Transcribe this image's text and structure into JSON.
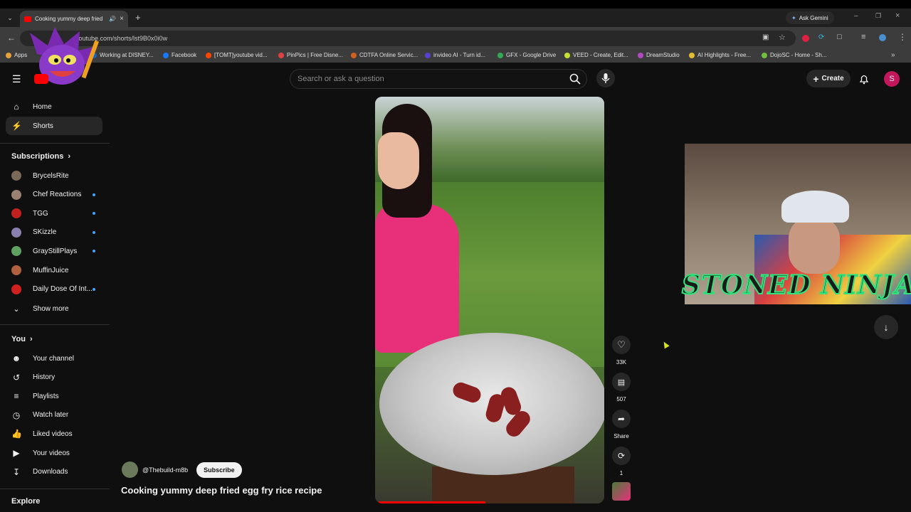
{
  "browser": {
    "tab_title": "Cooking yummy deep fried",
    "url": "youtube.com/shorts/lst9B0x0i0w",
    "ask_gemini": "Ask Gemini",
    "bookmarks": [
      {
        "label": "Apps",
        "color": "#e8a13a"
      },
      {
        "label": "Working at DISNEY...",
        "color": "#1565c0"
      },
      {
        "label": "Facebook",
        "color": "#1877f2"
      },
      {
        "label": "[TOMT]youtube vid...",
        "color": "#ff4500"
      },
      {
        "label": "PinPics | Free Disne...",
        "color": "#e04040"
      },
      {
        "label": "CDTFA Online Servic...",
        "color": "#d06020"
      },
      {
        "label": "invideo AI - Turn id...",
        "color": "#5a40d0"
      },
      {
        "label": "GFX - Google Drive",
        "color": "#34a853"
      },
      {
        "label": "VEED - Create, Edit...",
        "color": "#c8e030"
      },
      {
        "label": "DreamStudio",
        "color": "#b04ac0"
      },
      {
        "label": "AI Highlights - Free...",
        "color": "#e0c030"
      },
      {
        "label": "DojoSC - Home - Sh...",
        "color": "#70c040"
      }
    ]
  },
  "header": {
    "search_placeholder": "Search or ask a question",
    "create_label": "Create",
    "avatar_letter": "S"
  },
  "sidebar": {
    "main": [
      {
        "label": "Home",
        "icon": "home-icon"
      },
      {
        "label": "Shorts",
        "icon": "shorts-icon",
        "active": true
      }
    ],
    "subscriptions_title": "Subscriptions",
    "subscriptions": [
      {
        "label": "BrycelsRite",
        "color": "#7a6a5a",
        "dot": false
      },
      {
        "label": "Chef Reactions",
        "color": "#9a8070",
        "dot": true
      },
      {
        "label": "TGG",
        "color": "#c02020",
        "dot": true
      },
      {
        "label": "SKizzle",
        "color": "#8a80b0",
        "dot": true
      },
      {
        "label": "GrayStillPlays",
        "color": "#60a060",
        "dot": true
      },
      {
        "label": "MuffinJuice",
        "color": "#b06040",
        "dot": false
      },
      {
        "label": "Daily Dose Of Int...",
        "color": "#d02020",
        "dot": true
      }
    ],
    "show_more": "Show more",
    "you_title": "You",
    "you_items": [
      {
        "label": "Your channel",
        "icon": "channel-icon"
      },
      {
        "label": "History",
        "icon": "history-icon"
      },
      {
        "label": "Playlists",
        "icon": "playlists-icon"
      },
      {
        "label": "Watch later",
        "icon": "watch-later-icon"
      },
      {
        "label": "Liked videos",
        "icon": "like-icon"
      },
      {
        "label": "Your videos",
        "icon": "video-icon"
      },
      {
        "label": "Downloads",
        "icon": "download-icon"
      }
    ],
    "explore_title": "Explore"
  },
  "short": {
    "channel": "@Thebuild-m8b",
    "subscribe_label": "Subscribe",
    "title": "Cooking yummy deep fried egg fry rice recipe",
    "likes": "33K",
    "comments": "507",
    "share_label": "Share",
    "remix_count": "1"
  },
  "overlay": {
    "stream_text": "STONED NINJA"
  }
}
